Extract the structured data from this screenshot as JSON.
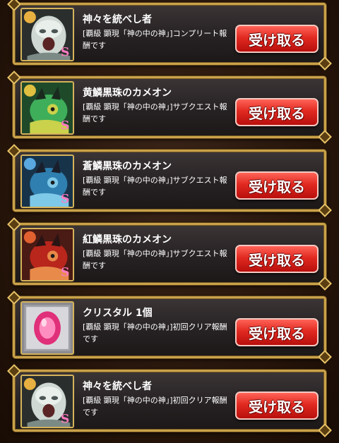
{
  "rewards": [
    {
      "name": "神々を統べし者",
      "description": "[覇級 顕現「神の中の神」]コンプリート報酬です",
      "button_label": "受け取る",
      "icon": "white-stone-face-monster-icon",
      "frame_color": "#e8b040",
      "art_colors": [
        "#cfd8d2",
        "#7c8a86"
      ]
    },
    {
      "name": "黄鱗黒珠のカメオン",
      "description": "[覇級 顕現「神の中の神」]サブクエスト報酬です",
      "button_label": "受け取る",
      "icon": "yellow-chameleon-monster-icon",
      "frame_color": "#e0c040",
      "art_colors": [
        "#3fae5a",
        "#c9d24a"
      ]
    },
    {
      "name": "蒼鱗黒珠のカメオン",
      "description": "[覇級 顕現「神の中の神」]サブクエスト報酬です",
      "button_label": "受け取る",
      "icon": "blue-chameleon-monster-icon",
      "frame_color": "#5aa8e0",
      "art_colors": [
        "#2f7fb0",
        "#7ec8e8"
      ]
    },
    {
      "name": "紅鱗黒珠のカメオン",
      "description": "[覇級 顕現「神の中の神」]サブクエスト報酬です",
      "button_label": "受け取る",
      "icon": "red-chameleon-monster-icon",
      "frame_color": "#e06030",
      "art_colors": [
        "#b8261c",
        "#e88a4a"
      ]
    },
    {
      "name": "クリスタル 1個",
      "description": "[覇級 顕現「神の中の神」]初回クリア報酬です",
      "button_label": "受け取る",
      "icon": "pink-crystal-icon",
      "frame_color": "#c8c8cc",
      "art_colors": [
        "#e0307a",
        "#ff8ec0"
      ]
    },
    {
      "name": "神々を統べし者",
      "description": "[覇級 顕現「神の中の神」]初回クリア報酬です",
      "button_label": "受け取る",
      "icon": "white-stone-face-monster-icon",
      "frame_color": "#e8b040",
      "art_colors": [
        "#cfd8d2",
        "#7c8a86"
      ]
    }
  ]
}
